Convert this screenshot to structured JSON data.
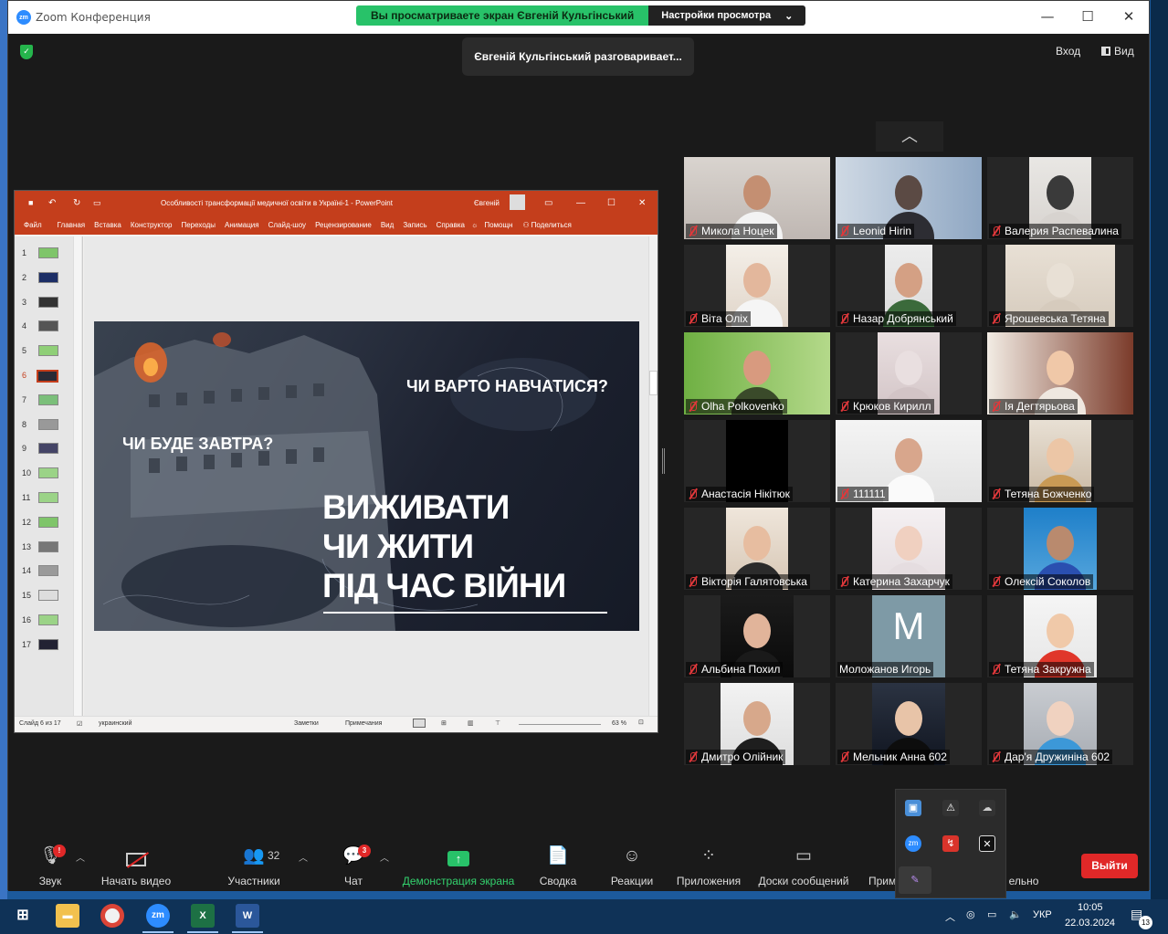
{
  "window": {
    "title": "Zoom Конференция",
    "logo": "zm"
  },
  "share_banner": {
    "viewing": "Вы просматриваете экран Євгеній Кульгінський",
    "options": "Настройки просмотра",
    "options_caret": "⌄"
  },
  "toast": "Євгеній Кульгінський разговаривает...",
  "top_right": {
    "login": "Вход",
    "view": "Вид"
  },
  "ppt": {
    "title": "Особливості трансформації медичної освіти в Україні-1  -  PowerPoint",
    "user": "Євгеній",
    "menu": [
      "Файл",
      "Главная",
      "Вставка",
      "Конструктор",
      "Переходы",
      "Анимация",
      "Слайд-шоу",
      "Рецензирование",
      "Вид",
      "Запись",
      "Справка",
      "Помощн",
      "Поделиться"
    ],
    "slides": [
      "1",
      "2",
      "3",
      "4",
      "5",
      "6",
      "7",
      "8",
      "9",
      "10",
      "11",
      "12",
      "13",
      "14",
      "15",
      "16",
      "17"
    ],
    "active_slide": "6",
    "slide_text": {
      "q1": "ЧИ ВАРТО НАВЧАТИСЯ?",
      "q2": "ЧИ БУДЕ ЗАВТРА?",
      "h1": "ВИЖИВАТИ",
      "h2": "ЧИ ЖИТИ",
      "h3": "ПІД ЧАС ВІЙНИ"
    },
    "status": {
      "slide": "Слайд 6 из 17",
      "lang": "украинский",
      "notes": "Заметки",
      "comments": "Примечания",
      "zoom": "63 %"
    }
  },
  "participants": [
    {
      "name": "Микола Ноцек"
    },
    {
      "name": "Leonid Hirin"
    },
    {
      "name": "Валерия Распевалина"
    },
    {
      "name": "Віта Оліх"
    },
    {
      "name": "Назар Добрянський"
    },
    {
      "name": "Ярошевська Тетяна"
    },
    {
      "name": "Olha Polkovenko"
    },
    {
      "name": "Крюков Кирилл"
    },
    {
      "name": "Ія Дегтярьова"
    },
    {
      "name": "Анастасія Нікітюк"
    },
    {
      "name": "111111"
    },
    {
      "name": "Тетяна Божченко"
    },
    {
      "name": "Вікторія Галятовська"
    },
    {
      "name": "Катерина Захарчук"
    },
    {
      "name": "Олексій Соколов"
    },
    {
      "name": "Альбина Похил"
    },
    {
      "name": "Моложанов Игорь",
      "avatar": "M"
    },
    {
      "name": "Тетяна Закружна"
    },
    {
      "name": "Дмитро Олійник"
    },
    {
      "name": "Мельник Анна 602"
    },
    {
      "name": "Дар'я Дружиніна 602"
    }
  ],
  "toolbar": {
    "audio": "Звук",
    "audio_badge": "!",
    "video": "Начать видео",
    "participants": "Участники",
    "participants_count": "32",
    "chat": "Чат",
    "chat_badge": "3",
    "share": "Демонстрация экрана",
    "summary": "Сводка",
    "reactions": "Реакции",
    "apps": "Приложения",
    "whiteboards": "Доски сообщений",
    "more_partial_left": "Прим",
    "more_partial_right": "ельно",
    "leave": "Выйти"
  },
  "taskbar": {
    "lang": "УКР",
    "time": "10:05",
    "date": "22.03.2024",
    "notifications": "13"
  },
  "colors": {
    "share_green": "#28c269",
    "leave_red": "#e02828",
    "ppt_red": "#c43e1c",
    "zoom_blue": "#2d8cff"
  }
}
